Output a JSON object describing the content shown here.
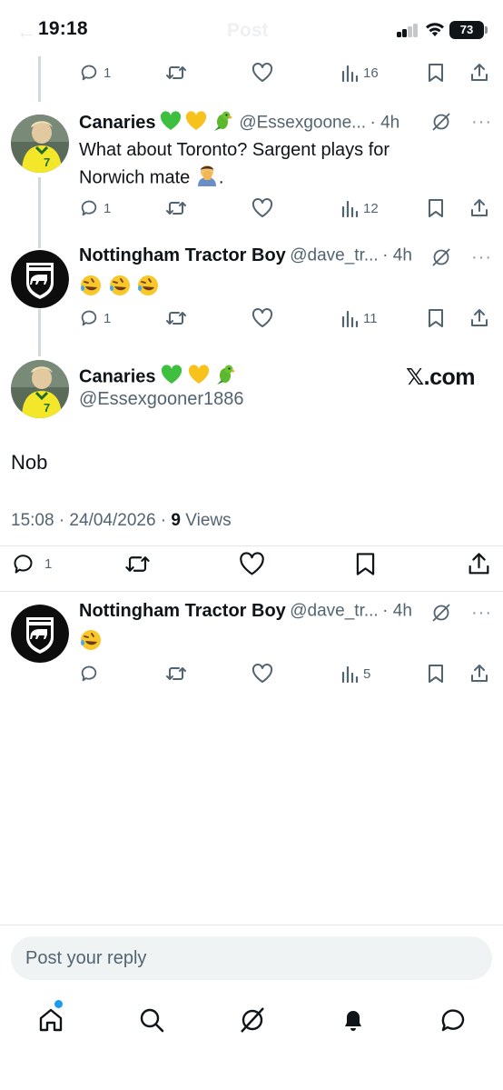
{
  "status_bar": {
    "time": "19:18",
    "battery": "73",
    "ghost_title": "Post"
  },
  "top_partial_actions": {
    "replies": "1",
    "views": "16"
  },
  "tweets": [
    {
      "name": "Canaries",
      "handle": "@Essexgoone...",
      "time": "· 4h",
      "text_line1": "What about Toronto? Sargent plays for",
      "text_line2": "Norwich mate",
      "text_suffix": ".",
      "replies": "1",
      "views": "12"
    },
    {
      "name": "Nottingham Tractor Boy",
      "handle": "@dave_tr...",
      "time": "· 4h",
      "replies": "1",
      "views": "11"
    }
  ],
  "main_tweet": {
    "name": "Canaries",
    "handle": "@Essexgooner1886",
    "source_logo": "𝕏.com",
    "text": "Nob",
    "timestamp": "15:08 · 24/04/2026 · ",
    "views_count": "9",
    "views_label": " Views",
    "replies": "1"
  },
  "reply_tweet": {
    "name": "Nottingham Tractor Boy",
    "handle": "@dave_tr...",
    "time": "· 4h",
    "views": "5"
  },
  "reply_bar": {
    "placeholder": "Post your reply"
  },
  "bottom_nav": [
    "home-icon",
    "search-icon",
    "grok-icon",
    "notifications-icon",
    "messages-icon"
  ],
  "colors": {
    "accent": "#1d9bf0",
    "secondary_text": "#536471",
    "primary_text": "#0f1419"
  }
}
